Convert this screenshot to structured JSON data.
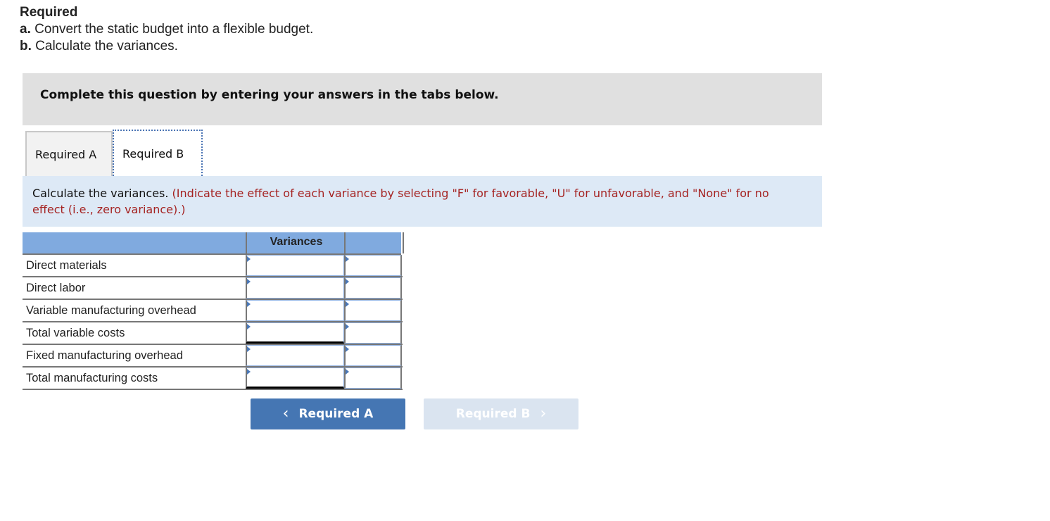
{
  "required": {
    "title": "Required",
    "items": [
      {
        "letter": "a.",
        "text": " Convert the static budget into a flexible budget."
      },
      {
        "letter": "b.",
        "text": " Calculate the variances."
      }
    ]
  },
  "instruction": "Complete this question by entering your answers in the tabs below.",
  "tabs": [
    {
      "label": "Required A",
      "active": false
    },
    {
      "label": "Required B",
      "active": true
    }
  ],
  "prompt": {
    "main": "Calculate the variances.",
    "note": " (Indicate the effect of each variance by selecting \"F\" for favorable, \"U\" for unfavorable, and \"None\" for no effect (i.e., zero variance).)"
  },
  "table": {
    "headers": [
      "",
      "Variances",
      ""
    ],
    "rows": [
      {
        "label": "Direct materials",
        "variance": "",
        "effect": "",
        "total": false
      },
      {
        "label": "Direct labor",
        "variance": "",
        "effect": "",
        "total": false
      },
      {
        "label": "Variable manufacturing overhead",
        "variance": "",
        "effect": "",
        "total": false
      },
      {
        "label": "Total variable costs",
        "variance": "",
        "effect": "",
        "total": true
      },
      {
        "label": "Fixed manufacturing overhead",
        "variance": "",
        "effect": "",
        "total": false
      },
      {
        "label": "Total manufacturing costs",
        "variance": "",
        "effect": "",
        "total": true
      }
    ]
  },
  "nav": {
    "prev_label": "Required A",
    "prev_icon": "‹",
    "next_label": "Required B",
    "next_icon": "›",
    "next_disabled": true
  },
  "colors": {
    "header_bg": "#80aadf",
    "prompt_bg": "#dde9f6",
    "note_red": "#a52322",
    "button_blue": "#4576b3",
    "button_disabled": "#dae4f0"
  }
}
